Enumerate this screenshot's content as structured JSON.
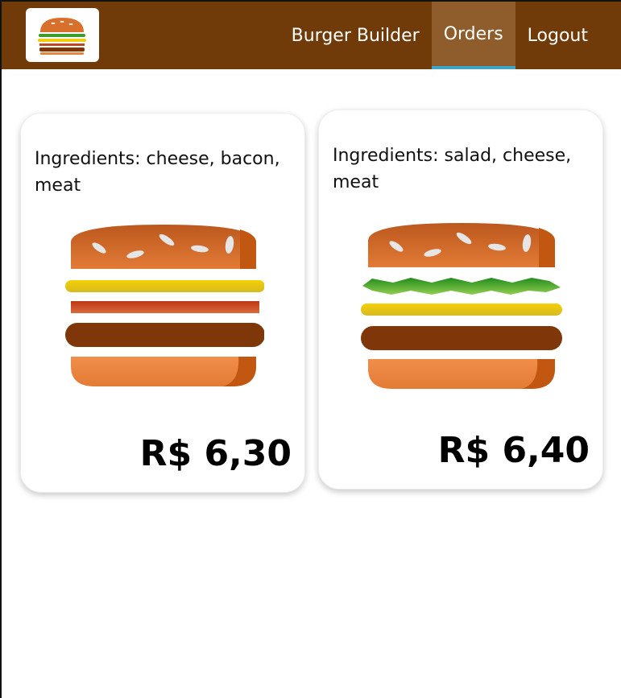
{
  "nav": {
    "logo_icon": "burger-logo-icon",
    "items": [
      {
        "label": "Burger Builder",
        "active": false
      },
      {
        "label": "Orders",
        "active": true
      },
      {
        "label": "Logout",
        "active": false
      }
    ]
  },
  "orders": [
    {
      "ingredients_text": "Ingredients: cheese, bacon, meat",
      "ingredients": [
        "cheese",
        "bacon",
        "meat"
      ],
      "price": "R$ 6,30"
    },
    {
      "ingredients_text": "Ingredients: salad, cheese, meat",
      "ingredients": [
        "salad",
        "cheese",
        "meat"
      ],
      "price": "R$ 6,40"
    }
  ],
  "colors": {
    "toolbar": "#703b09",
    "active_tab": "#8f5c2c",
    "active_underline": "#40a4c8",
    "bun": "#e27b36",
    "cheese": "#f4d004",
    "bacon": "#bf3813",
    "meat": "#7f3608",
    "salad": "#228c1d"
  }
}
